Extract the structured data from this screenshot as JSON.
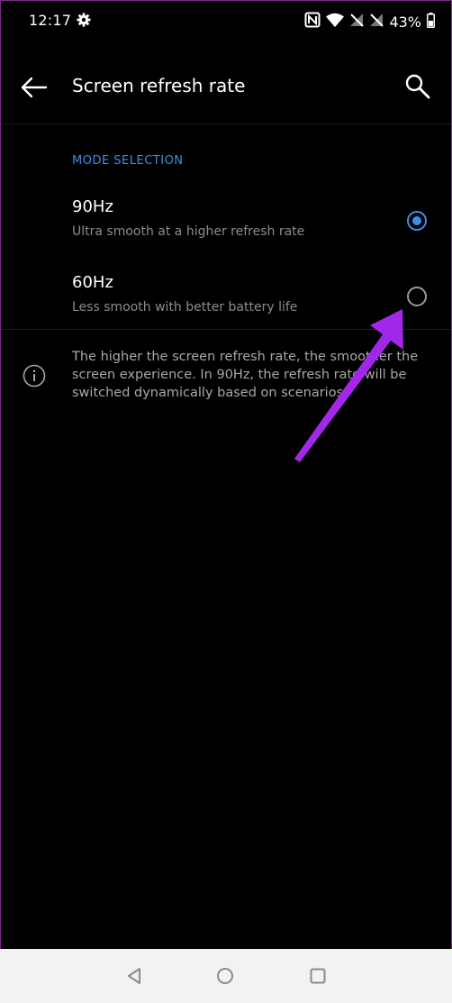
{
  "status_bar": {
    "time": "12:17",
    "battery_percent": "43%",
    "icons": [
      "gear-icon",
      "nfc-icon",
      "wifi-icon",
      "no-signal-icon",
      "no-signal-icon",
      "battery-icon"
    ]
  },
  "app_bar": {
    "title": "Screen refresh rate",
    "back_icon": "arrow-left-icon",
    "search_icon": "search-icon"
  },
  "mode_selection": {
    "header": "MODE SELECTION",
    "options": [
      {
        "title": "90Hz",
        "subtitle": "Ultra smooth at a higher refresh rate",
        "selected": true
      },
      {
        "title": "60Hz",
        "subtitle": "Less smooth with better battery life",
        "selected": false
      }
    ]
  },
  "info": {
    "icon": "info-icon",
    "text": "The higher the screen refresh rate, the smoother the screen experience. In 90Hz, the refresh rate will be switched dynamically based on scenarios."
  },
  "annotation": {
    "color": "#a128e8"
  },
  "nav_bar": {
    "buttons": [
      "back-triangle-icon",
      "home-circle-icon",
      "recents-square-icon"
    ]
  },
  "colors": {
    "accent": "#3e8ee8",
    "background": "#000000",
    "primary_text": "#ffffff",
    "secondary_text": "#8c8c8c"
  }
}
